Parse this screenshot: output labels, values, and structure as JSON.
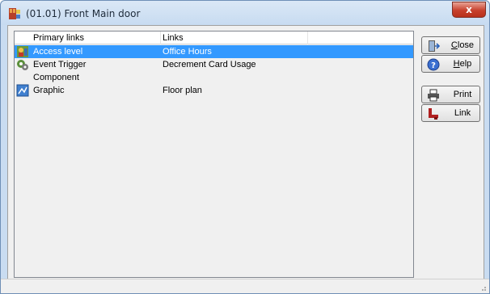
{
  "window": {
    "title": "(01.01) Front Main door",
    "close_glyph": "x"
  },
  "list": {
    "columns": [
      "Primary links",
      "Links"
    ],
    "rows": [
      {
        "icon": "access-level-icon",
        "primary": "Access level",
        "link": "Office Hours",
        "selected": true
      },
      {
        "icon": "event-trigger-icon",
        "primary": "Event Trigger",
        "link": "Decrement Card Usage",
        "selected": false
      },
      {
        "icon": "",
        "primary": "Component",
        "link": "",
        "selected": false
      },
      {
        "icon": "graphic-icon",
        "primary": "Graphic",
        "link": "Floor plan",
        "selected": false
      }
    ]
  },
  "buttons": {
    "close": {
      "label_pre": "",
      "label_ul": "C",
      "label_post": "lose",
      "icon": "exit-door-icon"
    },
    "help": {
      "label_pre": "",
      "label_ul": "H",
      "label_post": "elp",
      "icon": "help-icon"
    },
    "print": {
      "label": "Print",
      "icon": "printer-icon"
    },
    "link": {
      "label": "Link",
      "icon": "link-icon"
    }
  },
  "colors": {
    "selection": "#3399ff",
    "titlebar": "#c7dbf1",
    "close_button": "#c7402c"
  }
}
